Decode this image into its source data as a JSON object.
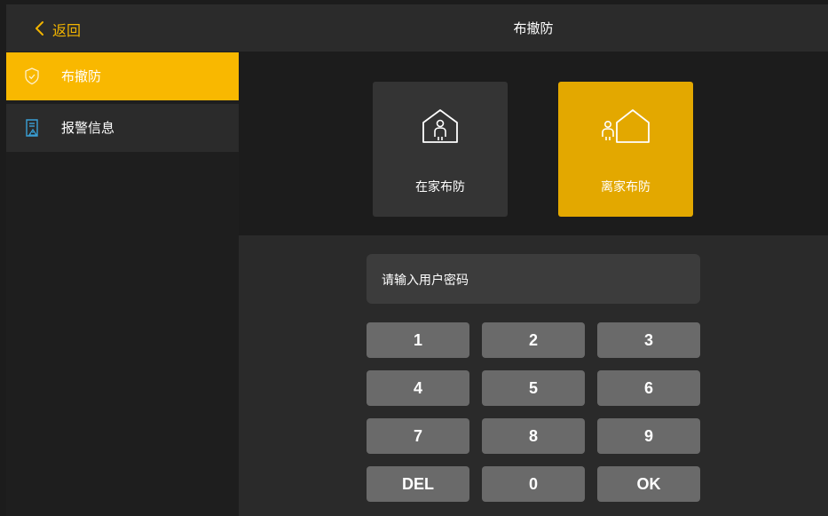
{
  "header": {
    "back_label": "返回",
    "title": "布撤防"
  },
  "sidebar": {
    "items": [
      {
        "label": "布撤防",
        "icon": "shield-check-icon",
        "active": true
      },
      {
        "label": "报警信息",
        "icon": "alarm-document-icon",
        "active": false
      }
    ]
  },
  "modes": [
    {
      "label": "在家布防",
      "icon": "person-in-house-icon",
      "selected": false
    },
    {
      "label": "离家布防",
      "icon": "person-leaving-house-icon",
      "selected": true
    }
  ],
  "password": {
    "placeholder": "请输入用户密码"
  },
  "keypad": {
    "keys": [
      "1",
      "2",
      "3",
      "4",
      "5",
      "6",
      "7",
      "8",
      "9",
      "DEL",
      "0",
      "OK"
    ]
  },
  "colors": {
    "accent": "#f9b800",
    "selected_card": "#e3a800",
    "background": "#1c1c1c",
    "panel": "#2b2b2b",
    "key": "#6a6a6a"
  }
}
